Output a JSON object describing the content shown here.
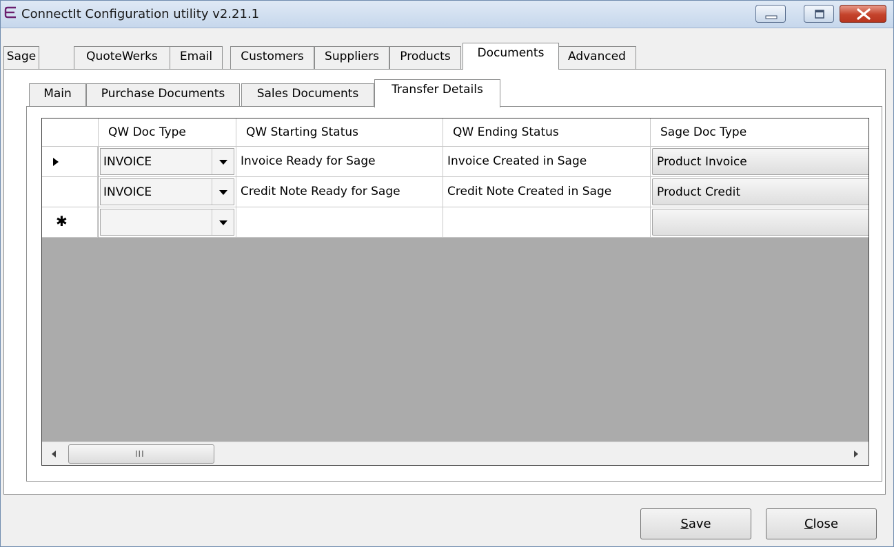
{
  "window": {
    "title": "ConnectIt Configuration utility v2.21.1"
  },
  "main_tabs": [
    {
      "label": "Sage"
    },
    {
      "label": "QuoteWerks"
    },
    {
      "label": "Email"
    },
    {
      "label": "Customers"
    },
    {
      "label": "Suppliers"
    },
    {
      "label": "Products"
    },
    {
      "label": "Documents",
      "active": true
    },
    {
      "label": "Advanced"
    }
  ],
  "sub_tabs": [
    {
      "label": "Main"
    },
    {
      "label": "Purchase Documents"
    },
    {
      "label": "Sales Documents"
    },
    {
      "label": "Transfer Details",
      "active": true
    }
  ],
  "grid": {
    "columns": [
      "QW Doc Type",
      "QW Starting Status",
      "QW Ending Status",
      "Sage Doc Type"
    ],
    "rows": [
      {
        "indicator": "current-row",
        "qw_doc_type": "INVOICE",
        "qw_starting_status": "Invoice Ready for Sage",
        "qw_ending_status": "Invoice Created in Sage",
        "sage_doc_type": "Product Invoice"
      },
      {
        "indicator": "",
        "qw_doc_type": "INVOICE",
        "qw_starting_status": "Credit Note Ready for Sage",
        "qw_ending_status": "Credit Note Created in Sage",
        "sage_doc_type": "Product Credit"
      },
      {
        "indicator": "new-row",
        "qw_doc_type": "",
        "qw_starting_status": "",
        "qw_ending_status": "",
        "sage_doc_type": ""
      }
    ],
    "new_row_marker": "✱",
    "scrollbar_grip": "III"
  },
  "buttons": {
    "save": {
      "mnemonic": "S",
      "rest": "ave"
    },
    "close": {
      "mnemonic": "C",
      "rest": "lose"
    }
  },
  "colors": {
    "grid_background": "#ababab",
    "close_button": "#c4432b",
    "app_icon": "#6b1f6e"
  }
}
